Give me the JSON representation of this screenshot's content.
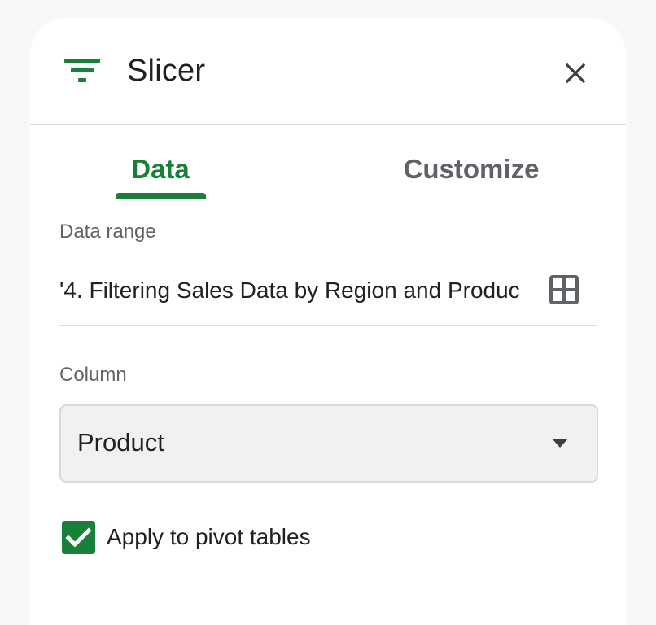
{
  "panel": {
    "title": "Slicer",
    "icons": {
      "header_icon": "filter-list-icon",
      "close_icon": "close-icon",
      "range_icon": "grid-select-icon",
      "dropdown_icon": "triangle-down-icon",
      "checkbox_icon": "checkmark-icon"
    },
    "tabs": [
      {
        "label": "Data",
        "selected": true
      },
      {
        "label": "Customize",
        "selected": false
      }
    ],
    "data_range": {
      "label": "Data range",
      "value": "'4. Filtering Sales Data by Region and Produc"
    },
    "column": {
      "label": "Column",
      "selected": "Product"
    },
    "pivot_tables": {
      "label": "Apply to pivot tables",
      "checked": true
    }
  },
  "colors": {
    "accent": "#188038",
    "text": "#202124",
    "secondary_text": "#5f6368",
    "divider": "#dadce0"
  }
}
